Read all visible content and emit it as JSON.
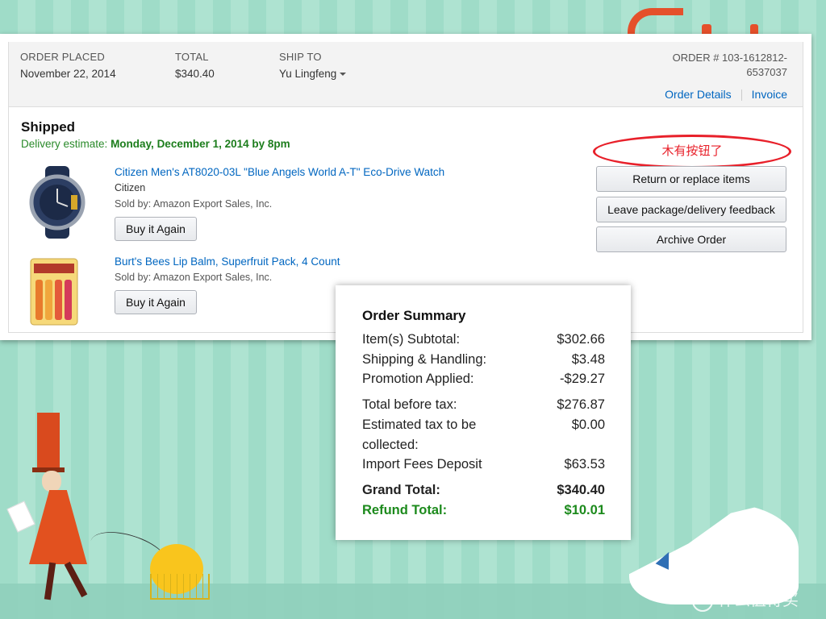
{
  "header": {
    "order_placed_label": "ORDER PLACED",
    "order_placed_value": "November 22, 2014",
    "total_label": "TOTAL",
    "total_value": "$340.40",
    "ship_to_label": "SHIP TO",
    "ship_to_value": "Yu Lingfeng",
    "order_number_line1": "ORDER # 103-1612812-",
    "order_number_line2": "6537037",
    "order_details_link": "Order Details",
    "invoice_link": "Invoice"
  },
  "shipment": {
    "status": "Shipped",
    "delivery_label": "Delivery estimate:",
    "delivery_value": "Monday, December 1, 2014 by 8pm"
  },
  "items": [
    {
      "title": "Citizen Men's AT8020-03L \"Blue Angels World A-T\" Eco-Drive Watch",
      "brand": "Citizen",
      "sold_by": "Sold by: Amazon Export Sales, Inc.",
      "buy_again": "Buy it Again"
    },
    {
      "title": "Burt's Bees Lip Balm, Superfruit Pack, 4 Count",
      "sold_by": "Sold by: Amazon Export Sales, Inc.",
      "buy_again": "Buy it Again"
    }
  ],
  "actions": {
    "annotation": "木有按钮了",
    "return_replace": "Return or replace items",
    "feedback": "Leave package/delivery feedback",
    "archive": "Archive Order"
  },
  "summary": {
    "title": "Order Summary",
    "rows": [
      {
        "label": "Item(s) Subtotal:",
        "value": "$302.66"
      },
      {
        "label": "Shipping & Handling:",
        "value": "$3.48"
      },
      {
        "label": "Promotion Applied:",
        "value": "-$29.27"
      },
      {
        "label": "Total before tax:",
        "value": "$276.87"
      },
      {
        "label": "Estimated tax to be",
        "label2": "collected:",
        "value": "$0.00"
      },
      {
        "label": "Import Fees Deposit",
        "value": "$63.53"
      },
      {
        "label": "Grand Total:",
        "value": "$340.40"
      },
      {
        "label": "Refund Total:",
        "value": "$10.01"
      }
    ]
  },
  "watermark": "什么值得买",
  "colors": {
    "link": "#0066c0",
    "delivery_green": "#1c7d1c",
    "annotation_red": "#e8202a",
    "background_mint": "#9fdcc8"
  }
}
